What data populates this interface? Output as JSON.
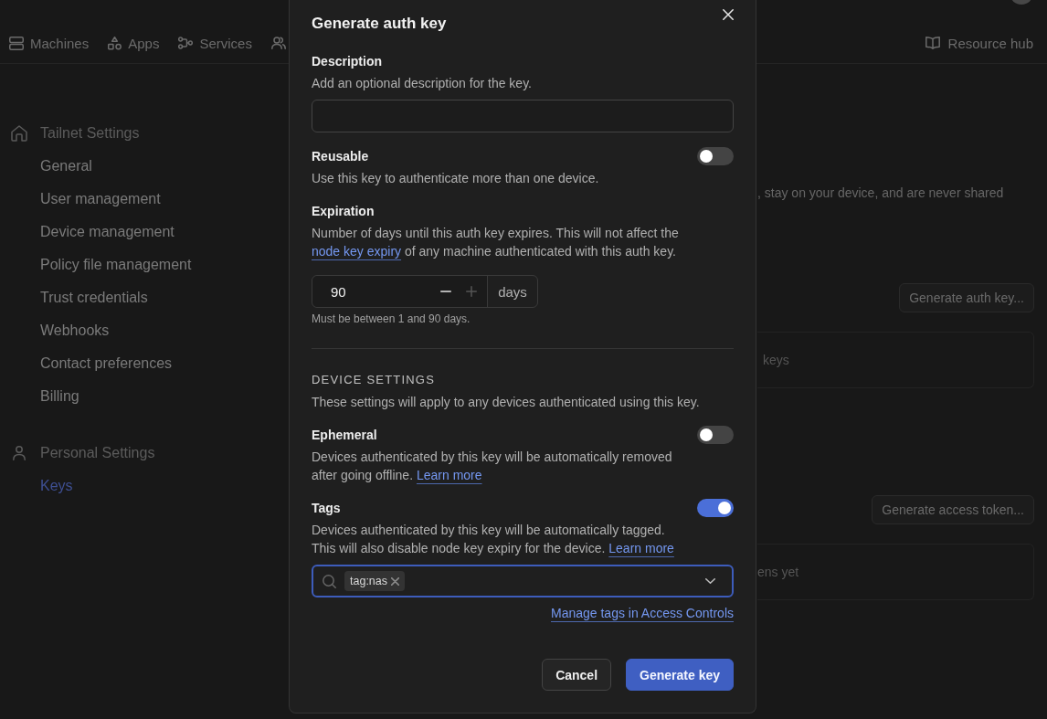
{
  "nav": {
    "items": [
      {
        "label": "Machines"
      },
      {
        "label": "Apps"
      },
      {
        "label": "Services"
      }
    ],
    "resource_link": "Resource hub"
  },
  "sidebar": {
    "sections": [
      {
        "title": "Tailnet Settings",
        "items": [
          {
            "label": "General",
            "selected": false
          },
          {
            "label": "User management",
            "selected": false
          },
          {
            "label": "Device management",
            "selected": false
          },
          {
            "label": "Policy file management",
            "selected": false
          },
          {
            "label": "Trust credentials",
            "selected": false
          },
          {
            "label": "Webhooks",
            "selected": false
          },
          {
            "label": "Contact preferences",
            "selected": false
          },
          {
            "label": "Billing",
            "selected": false
          }
        ]
      },
      {
        "title": "Personal Settings",
        "items": [
          {
            "label": "Keys",
            "selected": true
          }
        ]
      }
    ]
  },
  "content": {
    "intro_text": ", stay on your device, and are never shared",
    "sections": [
      {
        "button": "Generate auth key...",
        "empty_text": "keys"
      },
      {
        "button": "Generate access token...",
        "empty_text": "ens yet"
      }
    ]
  },
  "dialog": {
    "title": "Generate auth key",
    "fields": [
      {
        "kind": "text",
        "label": "Description",
        "help": "Add an optional description for the key."
      },
      {
        "kind": "toggle",
        "label": "Reusable",
        "help": "Use this key to authenticate more than one device.",
        "on": false
      },
      {
        "kind": "number",
        "label": "Expiration",
        "help": "Number of days until this auth key expires. This will not affect the",
        "link": "node key expiry",
        "help_end": "of any machine authenticated with this auth key.",
        "value": "90",
        "decrement_disabled": false,
        "increment_disabled": true,
        "unit": "days",
        "hint": "Must be between 1 and 90 days."
      }
    ],
    "device_settings": {
      "title": "DEVICE SETTINGS",
      "help": "These settings will apply to any devices authenticated using this key.",
      "fields": [
        {
          "kind": "toggle",
          "label": "Ephemeral",
          "help": "Devices authenticated by this key will be automatically removed after going offline.",
          "link": "Learn more",
          "on": false
        },
        {
          "kind": "toggle",
          "label": "Tags",
          "help": "Devices authenticated by this key will be automatically tagged. This will also disable node key expiry for the device.",
          "link": "Learn more",
          "on": true
        },
        {
          "kind": "tag_select",
          "chips": [
            {
              "label": "tag:nas"
            }
          ],
          "focused": true
        },
        {
          "kind": "link",
          "label": "Manage tags in Access Controls"
        }
      ]
    },
    "buttons": [
      {
        "label": "Cancel",
        "kind": "secondary"
      },
      {
        "label": "Generate key",
        "kind": "primary"
      }
    ]
  }
}
